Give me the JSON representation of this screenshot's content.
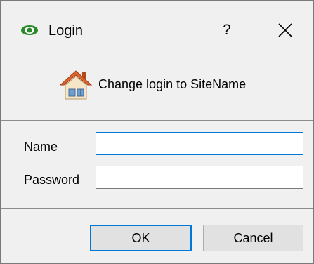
{
  "window": {
    "title": "Login",
    "app_icon": "eye-icon",
    "help_label": "?",
    "close_icon": "close-icon"
  },
  "header": {
    "icon": "home-icon",
    "text": "Change login to SiteName"
  },
  "form": {
    "name_label": "Name",
    "name_value": "",
    "password_label": "Password",
    "password_value": ""
  },
  "buttons": {
    "ok_label": "OK",
    "cancel_label": "Cancel"
  },
  "colors": {
    "accent": "#0078d7",
    "icon_green": "#2a8a2a",
    "home_roof": "#e0642a"
  }
}
